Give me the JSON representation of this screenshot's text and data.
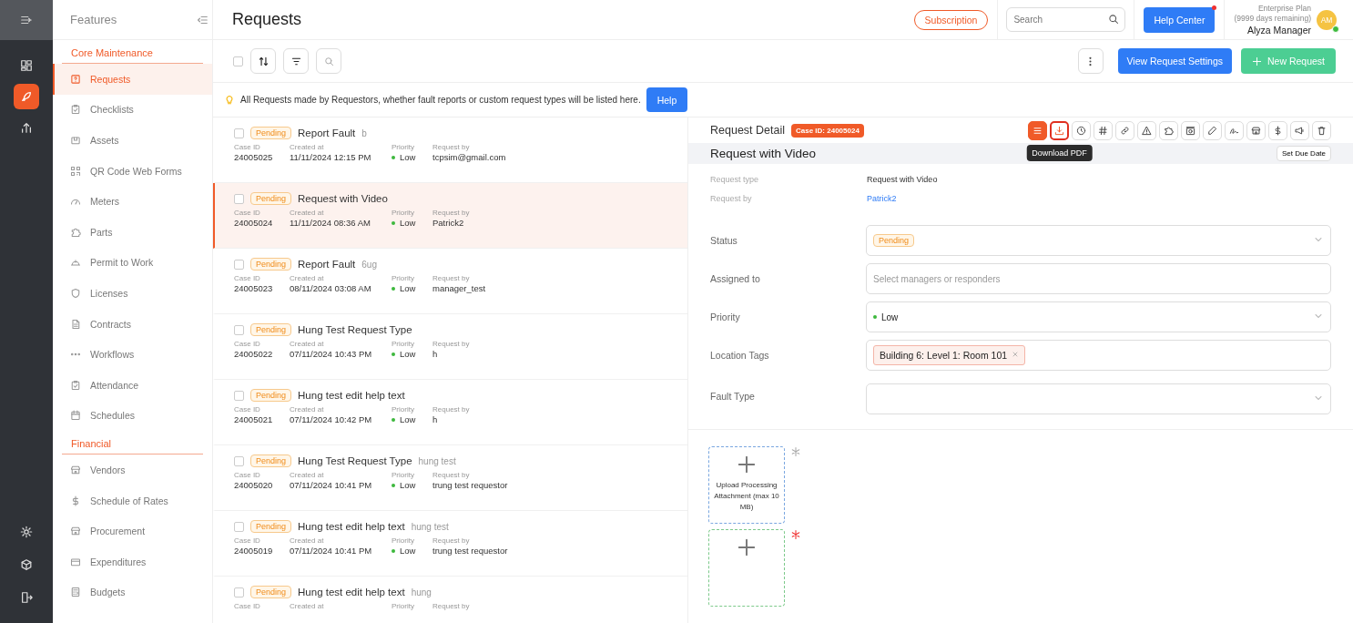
{
  "rail": {
    "items": [
      {
        "kind": "grid",
        "selected": false
      },
      {
        "kind": "rocket",
        "selected": true
      },
      {
        "kind": "chart",
        "selected": false
      }
    ],
    "bottom": [
      {
        "kind": "gear"
      },
      {
        "kind": "cube"
      },
      {
        "kind": "exit"
      }
    ]
  },
  "features": {
    "title": "Features",
    "sections": [
      {
        "title": "Core Maintenance",
        "items": [
          {
            "label": "Requests",
            "kind": "question",
            "selected": true
          },
          {
            "label": "Checklists",
            "kind": "checklist",
            "selected": false
          },
          {
            "label": "Assets",
            "kind": "box",
            "selected": false
          },
          {
            "label": "QR Code Web Forms",
            "kind": "qr",
            "selected": false
          },
          {
            "label": "Meters",
            "kind": "gauge",
            "selected": false
          },
          {
            "label": "Parts",
            "kind": "puzzle",
            "selected": false
          },
          {
            "label": "Permit to Work",
            "kind": "helmet",
            "selected": false
          },
          {
            "label": "Licenses",
            "kind": "shield",
            "selected": false
          },
          {
            "label": "Contracts",
            "kind": "document",
            "selected": false
          },
          {
            "label": "Workflows",
            "kind": "dots",
            "selected": false
          },
          {
            "label": "Attendance",
            "kind": "checklist",
            "selected": false
          },
          {
            "label": "Schedules",
            "kind": "calendar",
            "selected": false
          }
        ]
      },
      {
        "title": "Financial",
        "items": [
          {
            "label": "Vendors",
            "kind": "store",
            "selected": false
          },
          {
            "label": "Schedule of Rates",
            "kind": "dollar",
            "selected": false
          },
          {
            "label": "Procurement",
            "kind": "store",
            "selected": false
          },
          {
            "label": "Expenditures",
            "kind": "wallet",
            "selected": false
          },
          {
            "label": "Budgets",
            "kind": "calculator",
            "selected": false
          }
        ]
      }
    ]
  },
  "header": {
    "title": "Requests",
    "subscription": "Subscription",
    "search": {
      "placeholder": "Search"
    },
    "help_center": "Help Center",
    "help_center_badge": true,
    "plan": "Enterprise Plan",
    "plan_remaining": "(9999 days remaining)",
    "user_name": "Alyza Manager",
    "avatar": "AM",
    "online": true
  },
  "toolbar": {
    "select_all_checked": false,
    "view_settings": "View Request Settings",
    "new_request": "New Request"
  },
  "info": {
    "text": "All Requests made by Requestors, whether fault reports or custom request types will be listed here.",
    "help": "Help"
  },
  "list": {
    "rows": [
      {
        "status": "Pending",
        "title": "Report Fault",
        "subtitle": "b",
        "case_label": "Case ID",
        "created_label": "Created at",
        "priority_label": "Priority",
        "by_label": "Request by",
        "case_id": "24005025",
        "created": "11/11/2024 12:15 PM",
        "priority": "Low",
        "requested_by": "tcpsim@gmail.com",
        "selected": false,
        "checked": false
      },
      {
        "status": "Pending",
        "title": "Request with Video",
        "case_label": "Case ID",
        "created_label": "Created at",
        "priority_label": "Priority",
        "by_label": "Request by",
        "case_id": "24005024",
        "created": "11/11/2024 08:36 AM",
        "priority": "Low",
        "requested_by": "Patrick2",
        "selected": true,
        "checked": false
      },
      {
        "status": "Pending",
        "title": "Report Fault",
        "subtitle": "6ug",
        "case_label": "Case ID",
        "created_label": "Created at",
        "priority_label": "Priority",
        "by_label": "Request by",
        "case_id": "24005023",
        "created": "08/11/2024 03:08 AM",
        "priority": "Low",
        "requested_by": "manager_test",
        "selected": false,
        "checked": false
      },
      {
        "status": "Pending",
        "title": "Hung Test Request Type",
        "case_label": "Case ID",
        "created_label": "Created at",
        "priority_label": "Priority",
        "by_label": "Request by",
        "case_id": "24005022",
        "created": "07/11/2024 10:43 PM",
        "priority": "Low",
        "requested_by": "h",
        "selected": false,
        "checked": false
      },
      {
        "status": "Pending",
        "title": "Hung test edit help text",
        "case_label": "Case ID",
        "created_label": "Created at",
        "priority_label": "Priority",
        "by_label": "Request by",
        "case_id": "24005021",
        "created": "07/11/2024 10:42 PM",
        "priority": "Low",
        "requested_by": "h",
        "selected": false,
        "checked": false
      },
      {
        "status": "Pending",
        "title": "Hung Test Request Type",
        "subtitle": "hung test",
        "case_label": "Case ID",
        "created_label": "Created at",
        "priority_label": "Priority",
        "by_label": "Request by",
        "case_id": "24005020",
        "created": "07/11/2024 10:41 PM",
        "priority": "Low",
        "requested_by": "trung test requestor",
        "selected": false,
        "checked": false
      },
      {
        "status": "Pending",
        "title": "Hung test edit help text",
        "subtitle": "hung test",
        "case_label": "Case ID",
        "created_label": "Created at",
        "priority_label": "Priority",
        "by_label": "Request by",
        "case_id": "24005019",
        "created": "07/11/2024 10:41 PM",
        "priority": "Low",
        "requested_by": "trung test requestor",
        "selected": false,
        "checked": false
      },
      {
        "status": "Pending",
        "title": "Hung test edit help text",
        "subtitle": "hung",
        "case_label": "Case ID",
        "created_label": "Created at",
        "priority_label": "Priority",
        "by_label": "Request by",
        "selected": false,
        "checked": false
      }
    ]
  },
  "detail": {
    "title": "Request Detail",
    "case_badge": "Case ID: 24005024",
    "actions": [
      {
        "kind": "lines",
        "selected": true,
        "highlighted": false
      },
      {
        "kind": "download",
        "selected": false,
        "highlighted": true,
        "tooltip": "Download PDF"
      },
      {
        "kind": "clock",
        "selected": false,
        "highlighted": false
      },
      {
        "kind": "hash",
        "selected": false,
        "highlighted": false
      },
      {
        "kind": "link",
        "selected": false,
        "highlighted": false
      },
      {
        "kind": "warning",
        "selected": false,
        "highlighted": false
      },
      {
        "kind": "puzzle",
        "selected": false,
        "highlighted": false
      },
      {
        "kind": "camera",
        "selected": false,
        "highlighted": false
      },
      {
        "kind": "pencil",
        "selected": false,
        "highlighted": false
      },
      {
        "kind": "signature",
        "selected": false,
        "highlighted": false
      },
      {
        "kind": "store",
        "selected": false,
        "highlighted": false
      },
      {
        "kind": "dollar",
        "selected": false,
        "highlighted": false
      },
      {
        "kind": "megaphone",
        "selected": false,
        "highlighted": false
      },
      {
        "kind": "trash",
        "selected": false,
        "highlighted": false
      }
    ],
    "request_name": "Request with Video",
    "set_due_date": "Set Due Date",
    "info": [
      {
        "label": "Request type",
        "value": "Request with Video",
        "kind": "text"
      },
      {
        "label": "Request by",
        "value": "Patrick2",
        "kind": "link"
      }
    ],
    "fields": [
      {
        "label": "Status",
        "kind": "status",
        "value": "Pending",
        "dropdown": true
      },
      {
        "label": "Assigned to",
        "kind": "placeholder",
        "placeholder": "Select managers or responders",
        "dropdown": false
      },
      {
        "label": "Priority",
        "kind": "priority",
        "value": "Low",
        "dropdown": true
      },
      {
        "label": "Location Tags",
        "kind": "tags",
        "tags": [
          "Building 6: Level 1: Room 101"
        ],
        "dropdown": false
      },
      {
        "label": "Fault Type",
        "kind": "empty",
        "dropdown": true
      }
    ],
    "uploads": [
      {
        "label": "Upload Processing Attachment (max 10 MB)",
        "kind": "optional"
      },
      {
        "kind": "required"
      }
    ]
  }
}
